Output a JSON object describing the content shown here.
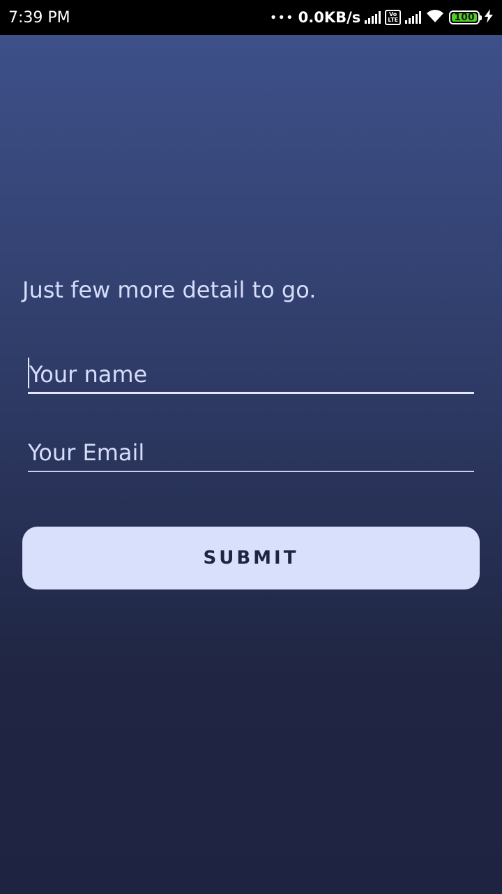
{
  "status_bar": {
    "time": "7:39 PM",
    "dots": "•••",
    "net_speed": "0.0KB/s",
    "volte_label": "Vo\nLTE",
    "battery_level": "100",
    "icons": [
      "signal-icon",
      "volte-icon",
      "signal-icon",
      "wifi-icon",
      "battery-icon",
      "charging-icon"
    ],
    "battery_color": "#4fd11f"
  },
  "form": {
    "heading": "Just few more detail to go.",
    "name_placeholder": "Your name",
    "name_value": "",
    "email_placeholder": "Your Email",
    "email_value": "",
    "submit_label": "SUBMIT"
  },
  "colors": {
    "background_top": "#3d5089",
    "background_bottom": "#1e2341",
    "text": "#d6dcfa",
    "button_bg": "#d9e0fc",
    "button_text": "#1e2543"
  }
}
